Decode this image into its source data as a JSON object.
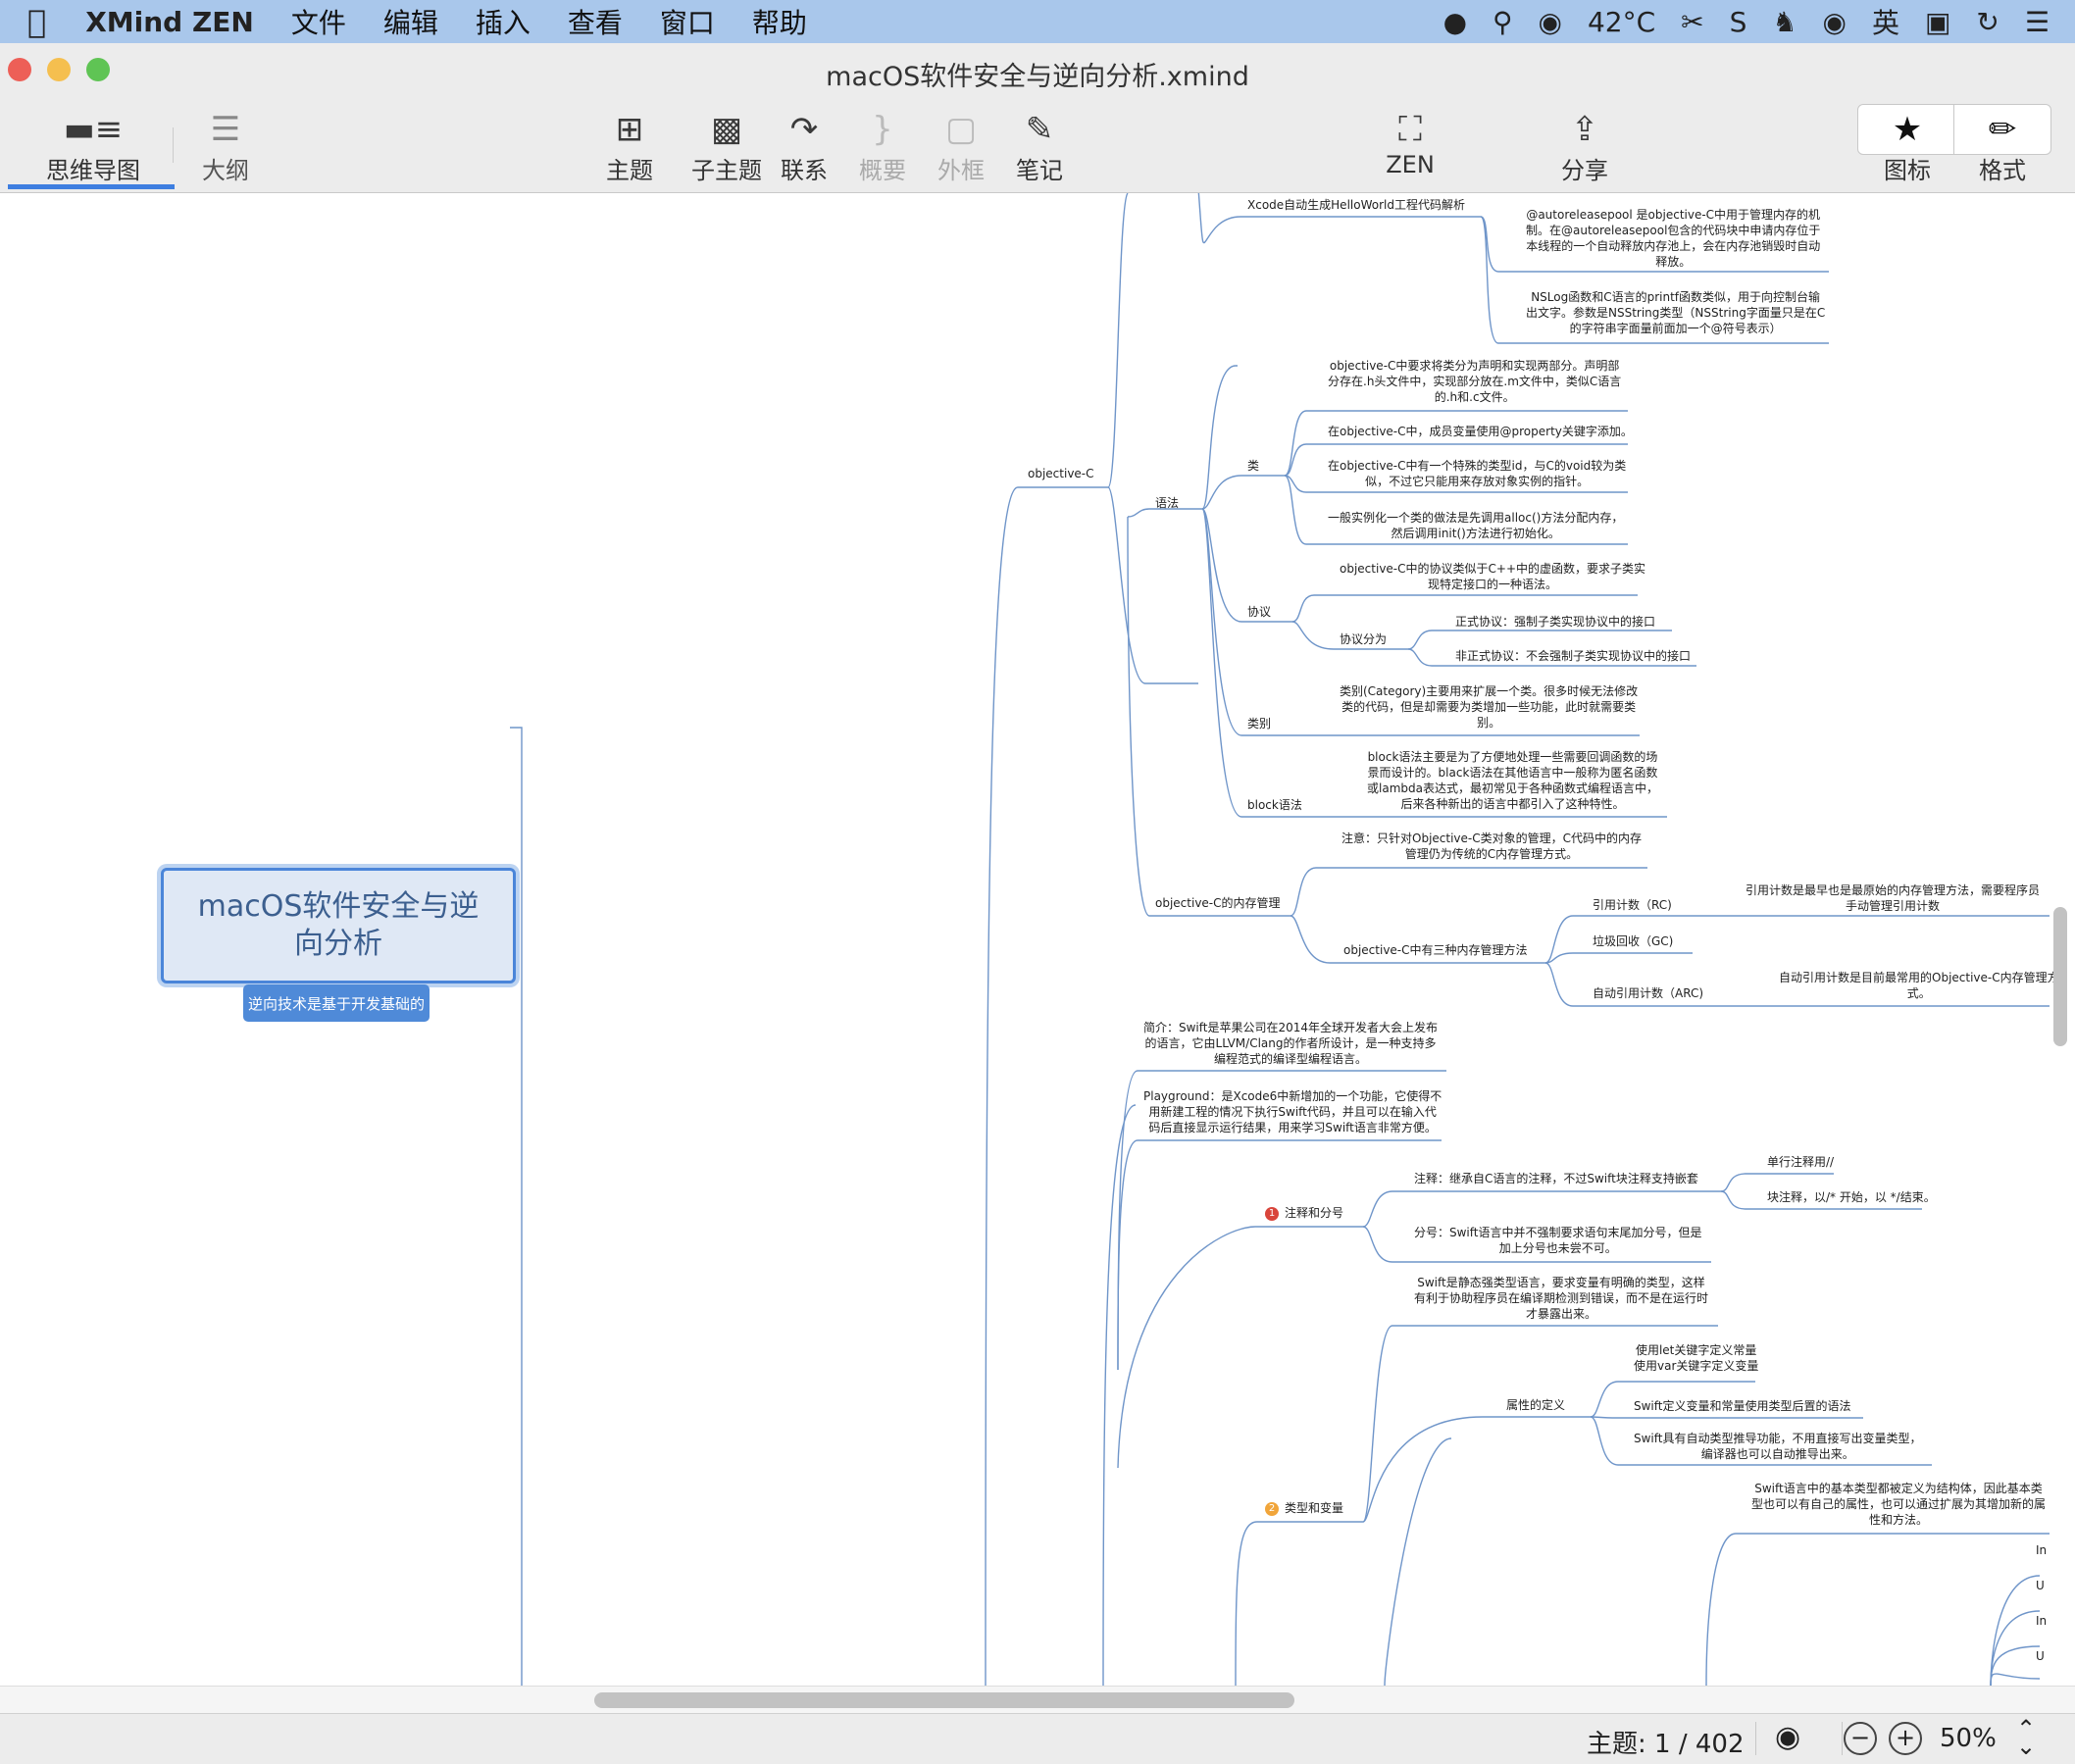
{
  "menubar": {
    "app_name": "XMind ZEN",
    "menus": [
      "文件",
      "编辑",
      "插入",
      "查看",
      "窗口",
      "帮助"
    ],
    "temperature": "42°C",
    "input_method": "英"
  },
  "window": {
    "title": "macOS软件安全与逆向分析.xmind"
  },
  "toolbar": {
    "view_mindmap": "思维导图",
    "view_outline": "大纲",
    "topic": "主题",
    "subtopic": "子主题",
    "relationship": "联系",
    "summary": "概要",
    "boundary": "外框",
    "note": "笔记",
    "zen": "ZEN",
    "share": "分享",
    "icon_panel": "图标",
    "format_panel": "格式"
  },
  "map": {
    "root": {
      "title": "macOS软件安全与逆向分析",
      "label": "逆向技术是基于开发基础的"
    },
    "nodes": {
      "xcode": "Xcode自动生成HelloWorld工程代码解析",
      "autorelease": [
        "@autoreleasepool 是objective-C中用于管理内存的机",
        "制。在@autoreleasepool包含的代码块中申请内存位于",
        "本线程的一个自动释放内存池上，会在内存池销毁时自动",
        "释放。"
      ],
      "nslog": [
        "NSLog函数和C语言的printf函数类似，用于向控制台输",
        "出文字。参数是NSString类型（NSString字面量只是在C",
        "的字符串字面量前面加一个@符号表示）"
      ],
      "objc": "objective-C",
      "syntax": "语法",
      "class": "类",
      "class_decl": [
        "objective-C中要求将类分为声明和实现两部分。声明部",
        "分存在.h头文件中，实现部分放在.m文件中，类似C语言",
        "的.h和.c文件。"
      ],
      "class_prop": "在objective-C中，成员变量使用@property关键字添加。",
      "class_id": [
        "在objective-C中有一个特殊的类型id，与C的void较为类",
        "似，不过它只能用来存放对象实例的指针。"
      ],
      "class_init": [
        "一般实例化一个类的做法是先调用alloc()方法分配内存，",
        "然后调用init()方法进行初始化。"
      ],
      "protocol": "协议",
      "protocol_desc": [
        "objective-C中的协议类似于C++中的虚函数，要求子类实",
        "现特定接口的一种语法。"
      ],
      "protocol_kinds": "协议分为",
      "formal": "正式协议：强制子类实现协议中的接口",
      "informal": "非正式协议：不会强制子类实现协议中的接口",
      "category": "类别",
      "category_desc": [
        "类别(Category)主要用来扩展一个类。很多时候无法修改",
        "类的代码，但是却需要为类增加一些功能，此时就需要类",
        "别。"
      ],
      "block": "block语法",
      "block_desc": [
        "block语法主要是为了方便地处理一些需要回调函数的场",
        "景而设计的。black语法在其他语言中一般称为匿名函数",
        "或lambda表达式，最初常见于各种函数式编程语言中，",
        "后来各种新出的语言中都引入了这种特性。"
      ],
      "memory": "objective-C的内存管理",
      "memory_note": [
        "注意：只针对Objective-C类对象的管理，C代码中的内存",
        "管理仍为传统的C内存管理方式。"
      ],
      "memory_methods": "objective-C中有三种内存管理方法",
      "rc": "引用计数（RC)",
      "rc_desc": [
        "引用计数是最早也是最原始的内存管理方法，需要程序员",
        "手动管理引用计数"
      ],
      "gc": "垃圾回收（GC)",
      "arc": "自动引用计数（ARC)",
      "arc_desc": [
        "自动引用计数是目前最常用的Objective-C内存管理方",
        "式。"
      ],
      "swift_intro": [
        "简介：Swift是苹果公司在2014年全球开发者大会上发布",
        "的语言，它由LLVM/Clang的作者所设计，是一种支持多",
        "编程范式的编译型编程语言。"
      ],
      "playground": [
        "Playground：是Xcode6中新增加的一个功能，它使得不",
        "用新建工程的情况下执行Swift代码，并且可以在输入代",
        "码后直接显示运行结果，用来学习Swift语言非常方便。"
      ],
      "comments": "注释和分号",
      "comments_marker": "1",
      "comment_desc": "注释：继承自C语言的注释，不过Swift块注释支持嵌套",
      "single_comment": "单行注释用//",
      "block_comment": "块注释，以/* 开始，以 */结束。",
      "semicolon": [
        "分号：Swift语言中并不强制要求语句末尾加分号，但是",
        "加上分号也未尝不可。"
      ],
      "types": "类型和变量",
      "types_marker": "2",
      "static_typed": [
        "Swift是静态强类型语言，要求变量有明确的类型，这样",
        "有利于协助程序员在编译期检测到错误，而不是在运行时",
        "才暴露出来。"
      ],
      "prop_def": "属性的定义",
      "let_var": [
        "使用let关键字定义常量",
        "使用var关键字定义变量"
      ],
      "type_after": "Swift定义变量和常量使用类型后置的语法",
      "inference": [
        "Swift具有自动类型推导功能，不用直接写出变量类型，",
        "编译器也可以自动推导出来。"
      ],
      "basic_types": [
        "Swift语言中的基本类型都被定义为结构体，因此基本类",
        "型也可以有自己的属性，也可以通过扩展为其增加新的属",
        "性和方法。"
      ],
      "cut_1": "In",
      "cut_2": "U",
      "cut_3": "In",
      "cut_4": "U"
    }
  },
  "status": {
    "topic_count": "主题: 1 / 402",
    "zoom": "50%"
  },
  "colors": {
    "menubar": "#a9c7eb",
    "accent": "#3e7ee0",
    "line": "#6f95c9",
    "root_fill": "#dfe8f5",
    "root_border": "#4a85d9"
  }
}
